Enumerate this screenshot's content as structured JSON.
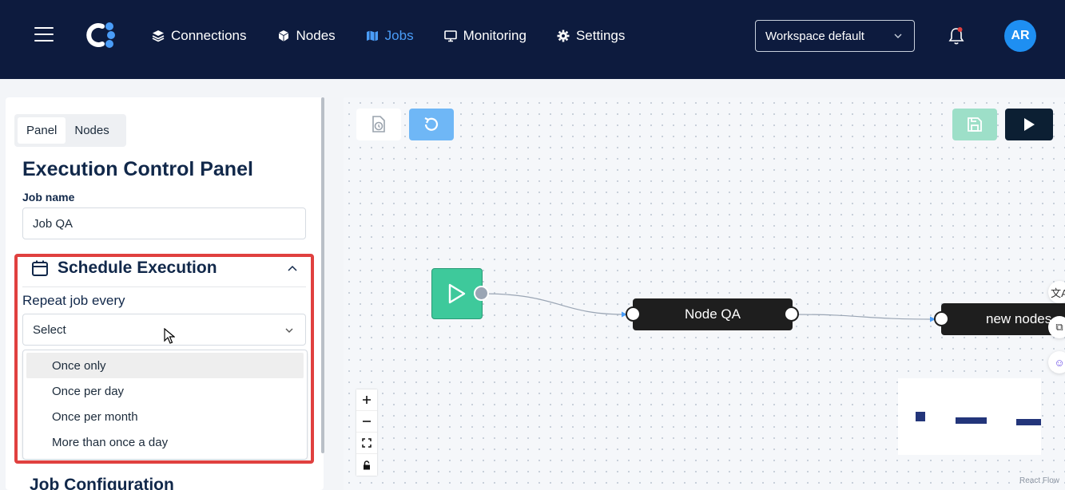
{
  "header": {
    "nav": [
      {
        "label": "Connections",
        "icon": "layers-icon",
        "active": false
      },
      {
        "label": "Nodes",
        "icon": "cube-icon",
        "active": false
      },
      {
        "label": "Jobs",
        "icon": "map-icon",
        "active": true
      },
      {
        "label": "Monitoring",
        "icon": "monitor-icon",
        "active": false
      },
      {
        "label": "Settings",
        "icon": "gear-icon",
        "active": false
      }
    ],
    "workspace": "Workspace default",
    "avatar_initials": "AR"
  },
  "panel": {
    "tabs": [
      "Panel",
      "Nodes"
    ],
    "active_tab": "Panel",
    "title": "Execution Control Panel",
    "job_name_label": "Job name",
    "job_name_value": "Job QA",
    "schedule": {
      "title": "Schedule Execution",
      "repeat_label": "Repeat job every",
      "select_placeholder": "Select",
      "options": [
        "Once only",
        "Once per day",
        "Once per month",
        "More than once a day"
      ],
      "hovered_option": "Once only"
    },
    "next_section": "Job Configuration"
  },
  "canvas": {
    "nodes": [
      {
        "label": "Node QA"
      },
      {
        "label": "new nodes"
      }
    ],
    "attribution": "React Flow",
    "side_buttons": [
      "文A",
      "⧉",
      "☺"
    ]
  },
  "colors": {
    "topbar": "#0d1b3e",
    "accent": "#4a9df8",
    "start_node": "#3ec99b",
    "highlight": "#e0403f"
  }
}
